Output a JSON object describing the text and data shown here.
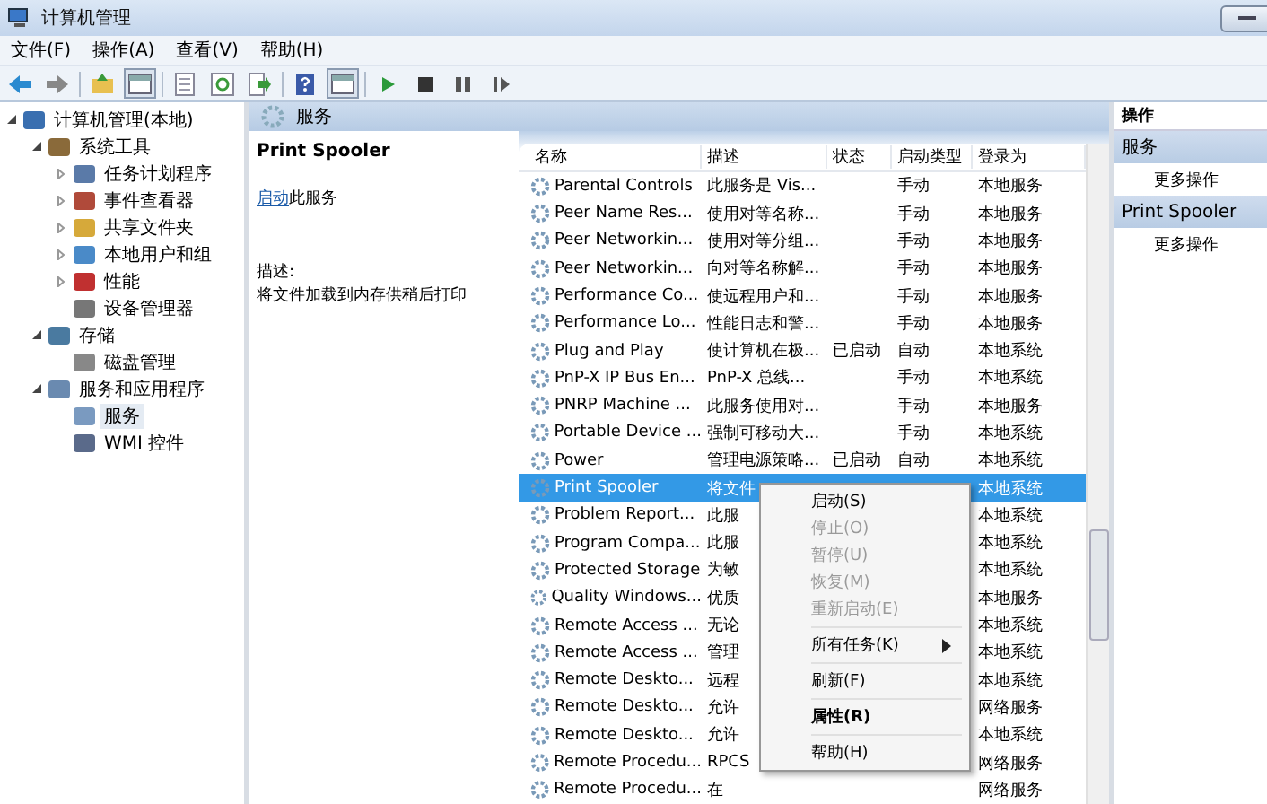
{
  "window": {
    "title": "计算机管理"
  },
  "menu_bar": [
    "文件(F)",
    "操作(A)",
    "查看(V)",
    "帮助(H)"
  ],
  "toolbar": [
    {
      "buttons": [
        {
          "kind": "back",
          "pressed": false
        },
        {
          "kind": "forward",
          "pressed": false
        }
      ]
    },
    {
      "buttons": [
        {
          "kind": "up",
          "pressed": false
        },
        {
          "kind": "pane",
          "pressed": true
        }
      ]
    },
    {
      "buttons": [
        {
          "kind": "list",
          "pressed": false
        },
        {
          "kind": "refresh",
          "pressed": false
        },
        {
          "kind": "export",
          "pressed": false
        }
      ]
    },
    {
      "buttons": [
        {
          "kind": "help",
          "pressed": false
        },
        {
          "kind": "pane",
          "pressed": true
        }
      ]
    },
    {
      "buttons": [
        {
          "kind": "play",
          "pressed": false
        },
        {
          "kind": "stop",
          "pressed": false
        },
        {
          "kind": "pause",
          "pressed": false
        },
        {
          "kind": "resume",
          "pressed": false
        }
      ]
    }
  ],
  "tree": [
    {
      "label": "计算机管理(本地)",
      "expanded": true,
      "selected": false,
      "children": [
        {
          "label": "系统工具",
          "expanded": true,
          "selected": false,
          "children": [
            {
              "label": "任务计划程序",
              "expanded": false,
              "selected": false
            },
            {
              "label": "事件查看器",
              "expanded": false,
              "selected": false
            },
            {
              "label": "共享文件夹",
              "expanded": false,
              "selected": false
            },
            {
              "label": "本地用户和组",
              "expanded": false,
              "selected": false
            },
            {
              "label": "性能",
              "expanded": false,
              "selected": false
            },
            {
              "label": "设备管理器",
              "selected": false
            }
          ]
        },
        {
          "label": "存储",
          "expanded": true,
          "selected": false,
          "children": [
            {
              "label": "磁盘管理",
              "selected": false
            }
          ]
        },
        {
          "label": "服务和应用程序",
          "expanded": true,
          "selected": false,
          "children": [
            {
              "label": "服务",
              "selected": true
            },
            {
              "label": "WMI 控件",
              "selected": false
            }
          ]
        }
      ]
    }
  ],
  "panel_header": "服务",
  "detail": {
    "service_name": "Print Spooler",
    "start_link": "启动",
    "start_text": "此服务",
    "desc_label": "描述:",
    "description": "将文件加载到内存供稍后打印"
  },
  "table": {
    "columns": [
      "名称",
      "描述",
      "状态",
      "启动类型",
      "登录为"
    ],
    "rows": [
      {
        "name": "Parental Controls",
        "desc": "此服务是 Vis...",
        "startup": "手动",
        "login": "本地服务",
        "selected": false
      },
      {
        "name": "Peer Name Res...",
        "desc": "使用对等名称...",
        "startup": "手动",
        "login": "本地服务",
        "selected": false
      },
      {
        "name": "Peer Networkin...",
        "desc": "使用对等分组...",
        "startup": "手动",
        "login": "本地服务",
        "selected": false
      },
      {
        "name": "Peer Networkin...",
        "desc": "向对等名称解...",
        "startup": "手动",
        "login": "本地服务",
        "selected": false
      },
      {
        "name": "Performance Co...",
        "desc": "使远程用户和...",
        "startup": "手动",
        "login": "本地服务",
        "selected": false
      },
      {
        "name": "Performance Lo...",
        "desc": "性能日志和警...",
        "startup": "手动",
        "login": "本地服务",
        "selected": false
      },
      {
        "name": "Plug and Play",
        "desc": "使计算机在极...",
        "status": "已启动",
        "startup": "自动",
        "login": "本地系统",
        "selected": false
      },
      {
        "name": "PnP-X IP Bus En...",
        "desc": "PnP-X 总线...",
        "startup": "手动",
        "login": "本地系统",
        "selected": false
      },
      {
        "name": "PNRP Machine ...",
        "desc": "此服务使用对...",
        "startup": "手动",
        "login": "本地服务",
        "selected": false
      },
      {
        "name": "Portable Device ...",
        "desc": "强制可移动大...",
        "startup": "手动",
        "login": "本地系统",
        "selected": false
      },
      {
        "name": "Power",
        "desc": "管理电源策略...",
        "status": "已启动",
        "startup": "自动",
        "login": "本地系统",
        "selected": false
      },
      {
        "name": "Print Spooler",
        "desc": "将文件",
        "login": "本地系统",
        "selected": true
      },
      {
        "name": "Problem Report...",
        "desc": "此服",
        "login": "本地系统",
        "selected": false
      },
      {
        "name": "Program Compa...",
        "desc": "此服",
        "login": "本地系统",
        "selected": false
      },
      {
        "name": "Protected Storage",
        "desc": "为敏",
        "login": "本地系统",
        "selected": false
      },
      {
        "name": "Quality Windows...",
        "desc": "优质",
        "login": "本地服务",
        "selected": false
      },
      {
        "name": "Remote Access ...",
        "desc": "无论",
        "login": "本地系统",
        "selected": false
      },
      {
        "name": "Remote Access ...",
        "desc": "管理",
        "login": "本地系统",
        "selected": false
      },
      {
        "name": "Remote Deskto...",
        "desc": "远程",
        "login": "本地系统",
        "selected": false
      },
      {
        "name": "Remote Deskto...",
        "desc": "允许",
        "login": "网络服务",
        "selected": false
      },
      {
        "name": "Remote Deskto...",
        "desc": "允许",
        "login": "本地系统",
        "selected": false
      },
      {
        "name": "Remote Procedu...",
        "desc": "RPCS",
        "login": "网络服务",
        "selected": false
      },
      {
        "name": "Remote Procedu...",
        "desc": "在",
        "login": "网络服务",
        "selected": false
      }
    ]
  },
  "context_menu": [
    {
      "kind": "item",
      "label": "启动(S)",
      "disabled": false,
      "bold": false,
      "submenu": false
    },
    {
      "kind": "item",
      "label": "停止(O)",
      "disabled": true,
      "bold": false,
      "submenu": false
    },
    {
      "kind": "item",
      "label": "暂停(U)",
      "disabled": true,
      "bold": false,
      "submenu": false
    },
    {
      "kind": "item",
      "label": "恢复(M)",
      "disabled": true,
      "bold": false,
      "submenu": false
    },
    {
      "kind": "item",
      "label": "重新启动(E)",
      "disabled": true,
      "bold": false,
      "submenu": false
    },
    {
      "kind": "separator"
    },
    {
      "kind": "item",
      "label": "所有任务(K)",
      "disabled": false,
      "bold": false,
      "submenu": true
    },
    {
      "kind": "separator"
    },
    {
      "kind": "item",
      "label": "刷新(F)",
      "disabled": false,
      "bold": false,
      "submenu": false
    },
    {
      "kind": "separator"
    },
    {
      "kind": "item",
      "label": "属性(R)",
      "disabled": false,
      "bold": true,
      "submenu": false
    },
    {
      "kind": "separator"
    },
    {
      "kind": "item",
      "label": "帮助(H)",
      "disabled": false,
      "bold": false,
      "submenu": false
    }
  ],
  "actions": {
    "title": "操作",
    "sections": [
      {
        "header": "服务",
        "items": [
          "更多操作"
        ]
      },
      {
        "header": "Print Spooler",
        "items": [
          "更多操作"
        ]
      }
    ]
  }
}
